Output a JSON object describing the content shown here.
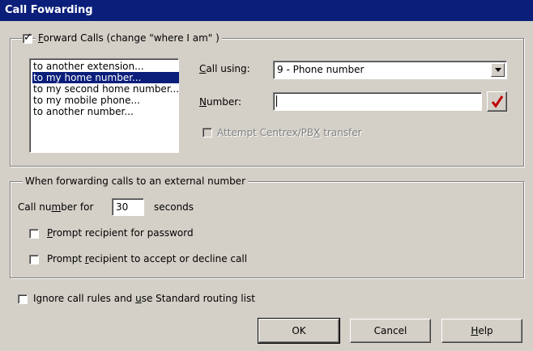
{
  "window": {
    "title": "Call Fowarding"
  },
  "forward_group": {
    "checkbox_checked": true,
    "label_accel": "F",
    "label_rest": "orward Calls (change \"where I am\" )",
    "list_items": [
      "to another extension...",
      "to my home number...",
      "to my second home number...",
      "to my mobile phone...",
      "to another number..."
    ],
    "selected_index": 1,
    "call_using_accel": "C",
    "call_using_rest": "all using:",
    "call_using_value": "9 - Phone number",
    "number_accel": "N",
    "number_rest": "umber:",
    "number_value": "",
    "centrex_pre": "Attempt Centrex/PB",
    "centrex_accel": "X",
    "centrex_post": " transfer"
  },
  "external_group": {
    "legend": "When forwarding calls to an external number",
    "call_number_pre": "Call nu",
    "call_number_accel": "m",
    "call_number_post": "ber for",
    "seconds_value": "30",
    "seconds_label": "seconds",
    "prompt_password_accel": "P",
    "prompt_password_rest": "rompt recipient for password",
    "prompt_accept_pre": "Prompt ",
    "prompt_accept_accel": "r",
    "prompt_accept_post": "ecipient to accept or decline call"
  },
  "ignore_rules": {
    "pre": "Ignore call rules and ",
    "accel": "u",
    "post": "se Standard routing list"
  },
  "buttons": {
    "ok": "OK",
    "cancel": "Cancel",
    "help_accel": "H",
    "help_rest": "elp"
  },
  "icons": {
    "dropdown": "chevron-down-icon",
    "checkmark": "red-checkmark-icon"
  },
  "colors": {
    "title_bar": "#0a1e7a",
    "selection": "#0a1e7a",
    "face": "#d4d0c8",
    "checkmark": "#c00000"
  }
}
